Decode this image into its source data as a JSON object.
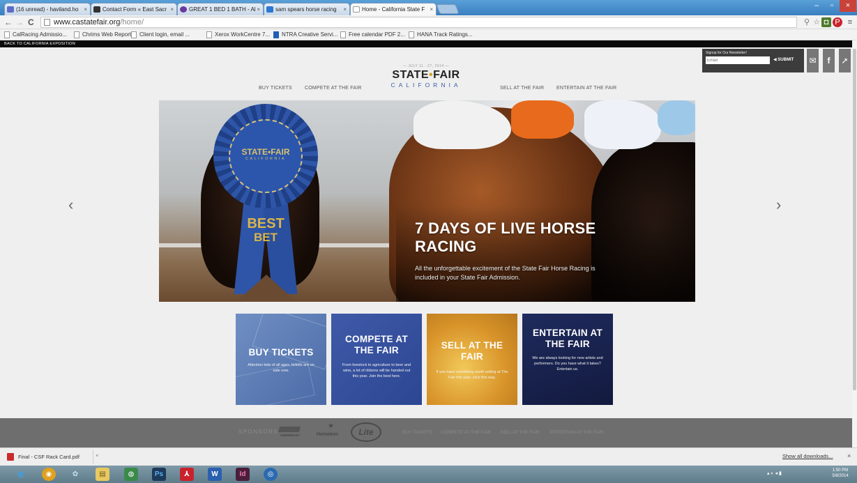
{
  "browser": {
    "tabs": [
      {
        "label": "(16 unread) - haviland.ho",
        "favicon_color": "#5b6dc7"
      },
      {
        "label": "Contact Form « East Sacr",
        "favicon_color": "#333333"
      },
      {
        "label": "GREAT 1 BED 1 BATH - Al",
        "favicon_color": "#6a3aa0"
      },
      {
        "label": "sam spears horse racing",
        "favicon_color": "#2a78d4"
      },
      {
        "label": "Home - California State F",
        "favicon_color": "#ffffff"
      }
    ],
    "tab_close_glyph": "×",
    "window_controls": [
      "–",
      "▫",
      "×"
    ],
    "url_host": "www.castatefair.org",
    "url_path": "/home/",
    "nav_back": "←",
    "nav_forward": "→",
    "nav_reload": "C",
    "bookmarks": [
      "CalRacing Admissio...",
      "Chrims Web Reporti...",
      "Client login, email ...",
      "Xerox WorkCentre 7...",
      "NTRA Creative Servi...",
      "Free calendar PDF 2...",
      "HANA Track Ratings..."
    ]
  },
  "site": {
    "back_link": "BACK TO CALIFORNIA EXPOSITION",
    "newsletter": {
      "label": "Signup for Our Newsletter!",
      "placeholder": "Email",
      "submit": "◀ SUBMIT"
    },
    "social": {
      "email": "✉",
      "facebook": "f",
      "twitter": "➚"
    },
    "logo": {
      "dates": "— JULY 11 - 27, 2014 —",
      "main_left": "STATE",
      "main_dot": "•",
      "main_right": "FAIR",
      "sub": "CALIFORNIA"
    },
    "nav": [
      "BUY TICKETS",
      "COMPETE AT THE FAIR",
      "SELL AT THE FAIR",
      "ENTERTAIN AT THE FAIR"
    ],
    "hero": {
      "ribbon_top": "STATE•FAIR",
      "ribbon_sub": "CALIFORNIA",
      "ribbon_best": "BEST",
      "ribbon_bet": "BET",
      "title": "7 DAYS OF LIVE HORSE RACING",
      "description": "All the unforgettable excitement of the State Fair Horse Racing is included in your State Fair Admission."
    },
    "carousel_prev": "‹",
    "carousel_next": "›",
    "cards": [
      {
        "title": "BUY TICKETS",
        "desc": "Attention kids of all ages, tickets are on sale now."
      },
      {
        "title": "COMPETE AT THE FAIR",
        "desc": "From livestock to agriculture to beer and wine, a lot of ribbons will be handed out this year. Join the best here."
      },
      {
        "title": "SELL AT THE FAIR",
        "desc": "If you have something worth selling at The Fair this year, click this way."
      },
      {
        "title": "ENTERTAIN AT THE FAIR",
        "desc": "We are always looking for new artists and performers. Do you have what it takes? Entertain us."
      }
    ],
    "footer": {
      "sponsors_label": "SPONSORS",
      "sponsors": [
        "CHEVROLET",
        "Heineken",
        "Lite"
      ],
      "nav": [
        "BUY TICKETS",
        "COMPETE AT THE FAIR",
        "SELL AT THE FAIR",
        "ENTERTAIN AT THE FAIR"
      ]
    }
  },
  "downloads": {
    "file": "Final - CSF Rack Card.pdf",
    "dropdown_glyph": "˅",
    "show_all": "Show all downloads...",
    "close": "×"
  },
  "taskbar": {
    "icons": [
      "e",
      "◉",
      "✿",
      "▤",
      "◍",
      "Ps",
      "⅄",
      "W",
      "Id",
      "◎"
    ],
    "clock_time": "1:50 PM",
    "clock_date": "5/8/2014"
  },
  "colors": {
    "brand_blue": "#3b5ca8",
    "brand_gold": "#d4a11e",
    "card_buy": "#5a7ab6",
    "card_compete": "#34509e",
    "card_sell": "#e2a63a",
    "card_entertain": "#18224c"
  }
}
